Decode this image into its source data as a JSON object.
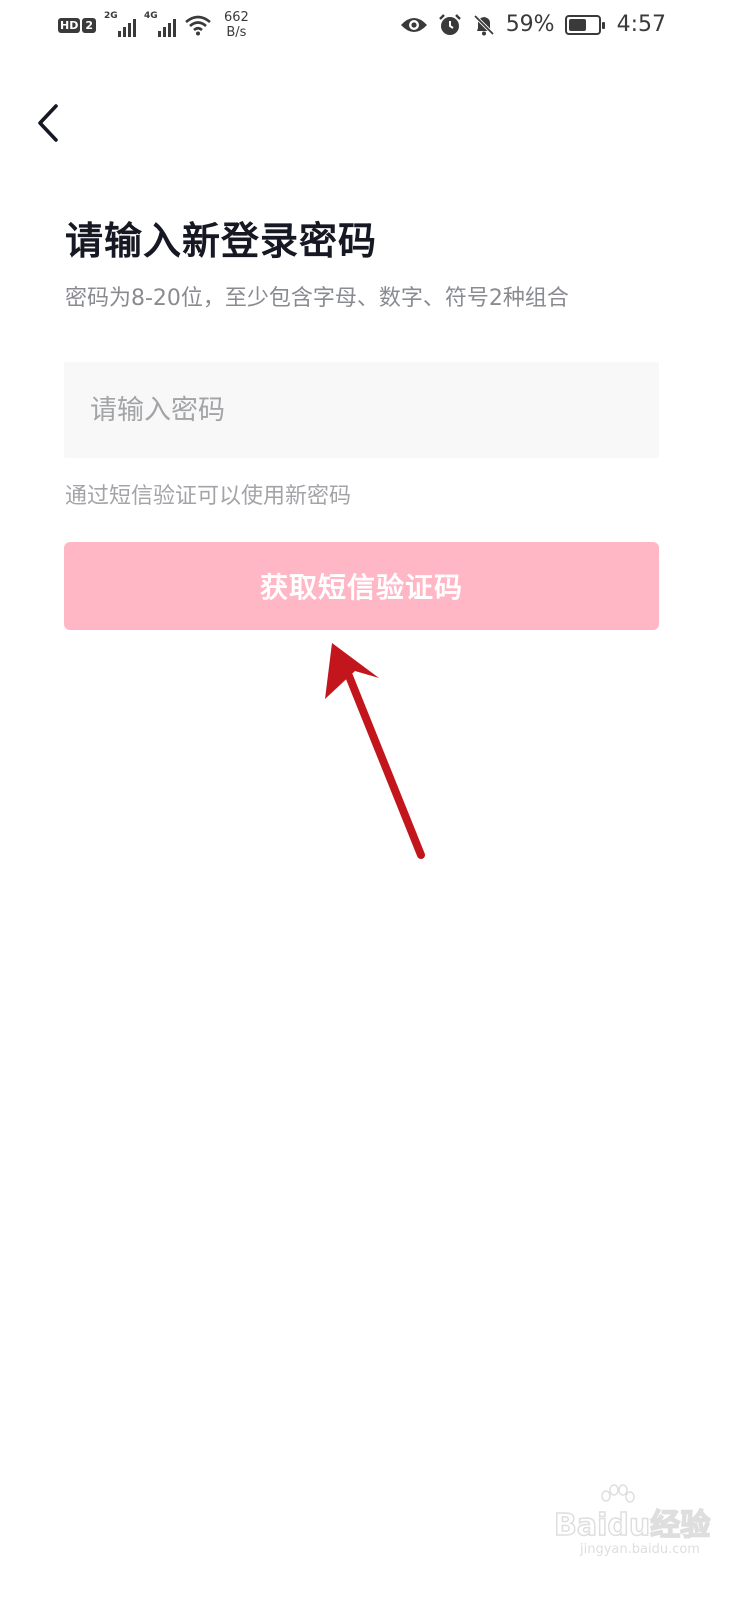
{
  "status_bar": {
    "hd_label": "HD",
    "hd_sim": "2",
    "signal1_tag": "2G",
    "signal2_tag": "4G",
    "net_speed_value": "662",
    "net_speed_unit": "B/s",
    "battery_percent": "59%",
    "battery_level": 0.59,
    "time": "4:57",
    "icons": [
      "eye-icon",
      "alarm-icon",
      "bell-muted-icon",
      "battery-icon"
    ]
  },
  "header": {
    "back_icon": "chevron-left-icon"
  },
  "main": {
    "title": "请输入新登录密码",
    "subtitle": "密码为8-20位，至少包含字母、数字、符号2种组合",
    "password_placeholder": "请输入密码",
    "password_value": "",
    "sms_hint": "通过短信验证可以使用新密码",
    "sms_button_label": "获取短信验证码"
  },
  "colors": {
    "title": "#161823",
    "subtitle": "#8a8b91",
    "button_bg": "#ffb6c5",
    "annotation_arrow": "#c3161c"
  },
  "watermark": {
    "main": "Baidu经验",
    "sub": "jingyan.baidu.com"
  }
}
